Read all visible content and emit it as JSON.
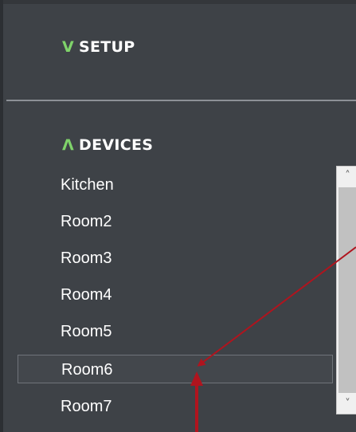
{
  "sections": {
    "setup": {
      "chevron": "V",
      "label": "SETUP"
    },
    "devices": {
      "chevron": "Λ",
      "label": "DEVICES"
    }
  },
  "devices": {
    "items": [
      "Kitchen",
      "Room2",
      "Room3",
      "Room4",
      "Room5",
      "Room6",
      "Room7"
    ],
    "selected_index": 5
  },
  "scrollbar": {
    "up_icon": "chevron-up-icon",
    "down_icon": "chevron-down-icon",
    "up_glyph": "˄",
    "down_glyph": "˅"
  },
  "colors": {
    "panel_bg": "#3e4247",
    "chevron_green": "#7fd36a",
    "annotation_red": "#b0141e"
  }
}
